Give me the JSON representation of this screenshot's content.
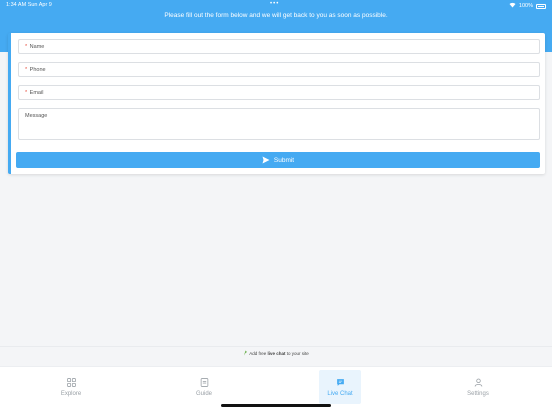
{
  "status_bar": {
    "time_date": "1:34 AM   Sun Apr 9",
    "dots": "•••",
    "battery": "100%"
  },
  "header": {
    "text": "Please fill out the form below and we will get back to you as soon as possible."
  },
  "form": {
    "name_label": "Name",
    "phone_label": "Phone",
    "email_label": "Email",
    "message_label": "Message",
    "required_mark": "*",
    "submit_label": "Submit"
  },
  "branding": {
    "prefix": "Add free",
    "highlight": "live chat",
    "suffix": "to your site"
  },
  "tabs": [
    {
      "label": "Explore",
      "icon": "grid-icon"
    },
    {
      "label": "Guide",
      "icon": "document-icon"
    },
    {
      "label": "Live Chat",
      "icon": "chat-icon",
      "active": true
    },
    {
      "label": "Settings",
      "icon": "user-icon"
    }
  ],
  "colors": {
    "accent": "#45aaf2",
    "background": "#f4f5f7",
    "required": "#e74c3c"
  }
}
